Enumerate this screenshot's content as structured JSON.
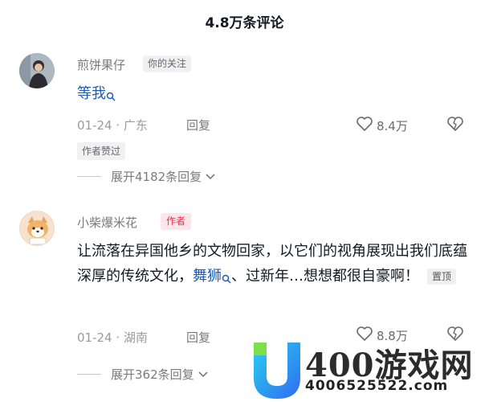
{
  "header": {
    "title": "4.8万条评论"
  },
  "comments": [
    {
      "username": "煎饼果仔",
      "follow_tag": "你的关注",
      "text": "等我",
      "date": "01-24",
      "location": "广东",
      "reply_label": "回复",
      "likes": "8.4万",
      "author_liked": "作者赞过",
      "expand": "展开4182条回复"
    },
    {
      "username": "小柴爆米花",
      "author_tag": "作者",
      "text_part1": "让流落在异国他乡的文物回家，以它们的视角展现出我们底蕴深厚的传统文化，",
      "highlight": "舞狮",
      "text_part2": "、过新年…想想都很自豪啊！",
      "pinned": "置顶",
      "date": "01-24",
      "location": "湖南",
      "reply_label": "回复",
      "likes": "8.8万",
      "expand": "展开362条回复"
    }
  ],
  "watermark": {
    "text": "400游戏网",
    "number": "4006525522.com"
  },
  "colors": {
    "author_red": "#fe2c55",
    "link_blue": "#1f5bb5",
    "muted": "#9a9aa0"
  },
  "icons": [
    "search-icon",
    "heart-icon",
    "broken-heart-icon",
    "chevron-down-icon"
  ]
}
